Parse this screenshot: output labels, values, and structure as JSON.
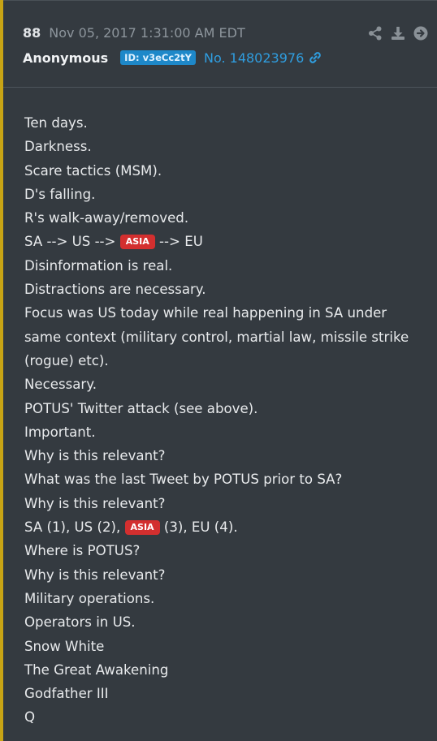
{
  "post": {
    "number": "88",
    "timestamp": "Nov 05, 2017 1:31:00 AM EDT",
    "author": "Anonymous",
    "id_badge": "ID: v3eCc2tY",
    "post_id": "No. 148023976",
    "accent_color": "#c8a415",
    "id_badge_color": "#1e88c9",
    "link_color": "#2f9ee0",
    "tag_color": "#d32f2f"
  },
  "actions": {
    "share_icon": "share-icon",
    "download_icon": "download-icon",
    "go_icon": "arrow-circle-right-icon"
  },
  "body": {
    "lines": [
      "Ten days.",
      "Darkness.",
      "Scare tactics (MSM).",
      "D's falling.",
      "R's walk-away/removed.",
      {
        "pre": "SA --> US --> ",
        "tag": "ASIA",
        "post": " --> EU"
      },
      "Disinformation is real.",
      "Distractions are necessary.",
      "Focus was US today while real happening in SA under same context (military control, martial law, missile strike (rogue) etc).",
      "Necessary.",
      "POTUS' Twitter attack (see above).",
      "Important.",
      "Why is this relevant?",
      "What was the last Tweet by POTUS prior to SA?",
      "Why is this relevant?",
      {
        "pre": "SA (1), US (2), ",
        "tag": "ASIA",
        "post": " (3), EU (4)."
      },
      "Where is POTUS?",
      "Why is this relevant?",
      "Military operations.",
      "Operators in US.",
      "Snow White",
      "The Great Awakening",
      "Godfather III",
      "Q"
    ]
  }
}
